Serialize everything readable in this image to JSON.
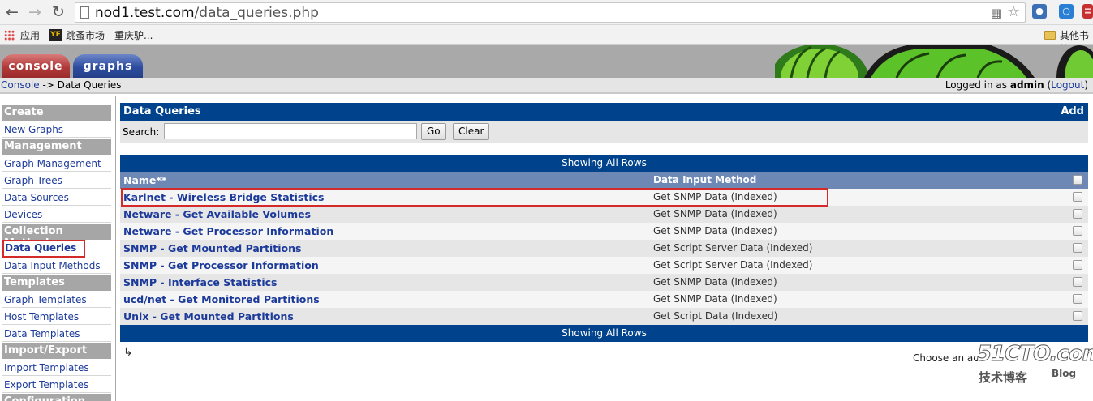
{
  "browser": {
    "url_host": "nod1.test.com",
    "url_path": "/data_queries.php",
    "bookmarks": {
      "apps": "应用",
      "site": "跳蚤市场 - 重庆驴...",
      "other": "其他书签"
    }
  },
  "tabs": {
    "console": "console",
    "graphs": "graphs"
  },
  "breadcrumb": {
    "console": "Console",
    "separator": " -> ",
    "current": "Data Queries"
  },
  "login": {
    "prefix": "Logged in as ",
    "user": "admin",
    "logout": "Logout"
  },
  "sidebar": [
    {
      "type": "head",
      "label": "Create"
    },
    {
      "type": "item",
      "label": "New Graphs"
    },
    {
      "type": "head",
      "label": "Management"
    },
    {
      "type": "item",
      "label": "Graph Management"
    },
    {
      "type": "item",
      "label": "Graph Trees"
    },
    {
      "type": "item",
      "label": "Data Sources"
    },
    {
      "type": "item",
      "label": "Devices"
    },
    {
      "type": "head",
      "label": "Collection Methods"
    },
    {
      "type": "item",
      "label": "Data Queries",
      "selected": true
    },
    {
      "type": "item",
      "label": "Data Input Methods"
    },
    {
      "type": "head",
      "label": "Templates"
    },
    {
      "type": "item",
      "label": "Graph Templates"
    },
    {
      "type": "item",
      "label": "Host Templates"
    },
    {
      "type": "item",
      "label": "Data Templates"
    },
    {
      "type": "head",
      "label": "Import/Export"
    },
    {
      "type": "item",
      "label": "Import Templates"
    },
    {
      "type": "item",
      "label": "Export Templates"
    },
    {
      "type": "head",
      "label": "Configuration"
    }
  ],
  "filter": {
    "title": "Data Queries",
    "add_label": "Add",
    "search_label": "Search:",
    "search_value": "",
    "go_label": "Go",
    "clear_label": "Clear"
  },
  "table": {
    "showing_label": "Showing All Rows",
    "columns": {
      "name": "Name**",
      "method": "Data Input Method"
    },
    "rows": [
      {
        "name": "Karlnet - Wireless Bridge Statistics",
        "method": "Get SNMP Data (Indexed)"
      },
      {
        "name": "Netware - Get Available Volumes",
        "method": "Get SNMP Data (Indexed)"
      },
      {
        "name": "Netware - Get Processor Information",
        "method": "Get SNMP Data (Indexed)"
      },
      {
        "name": "SNMP - Get Mounted Partitions",
        "method": "Get Script Server Data (Indexed)"
      },
      {
        "name": "SNMP - Get Processor Information",
        "method": "Get Script Server Data (Indexed)"
      },
      {
        "name": "SNMP - Interface Statistics",
        "method": "Get SNMP Data (Indexed)"
      },
      {
        "name": "ucd/net - Get Monitored Partitions",
        "method": "Get SNMP Data (Indexed)"
      },
      {
        "name": "Unix - Get Mounted Partitions",
        "method": "Get Script Data (Indexed)"
      }
    ]
  },
  "footer": {
    "choose_action": "Choose an ac"
  },
  "watermark": {
    "big": "51CTO.com",
    "cn": "技术博客",
    "blog": "Blog"
  }
}
